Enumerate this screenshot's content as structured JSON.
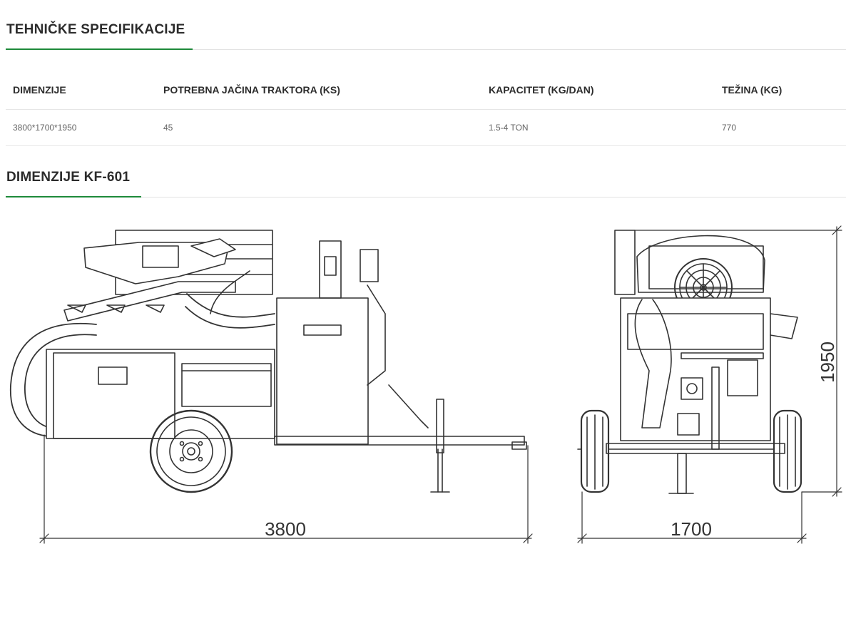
{
  "sections": {
    "specs_title": "TEHNIČKE SPECIFIKACIJE",
    "dims_title": "DIMENZIJE KF-601"
  },
  "table": {
    "headers": [
      "DIMENZIJE",
      "POTREBNA JAČINA TRAKTORA (KS)",
      "KAPACITET (KG/DAN)",
      "TEŽINA (KG)"
    ],
    "values": [
      "3800*1700*1950",
      "45",
      "1.5-4 TON",
      "770"
    ]
  },
  "drawing": {
    "length_label": "3800",
    "width_label": "1700",
    "height_label": "1950"
  },
  "colors": {
    "accent": "#1e8a3a",
    "divider": "#e3e3e3",
    "text": "#2c2c2c",
    "muted": "#666666"
  }
}
